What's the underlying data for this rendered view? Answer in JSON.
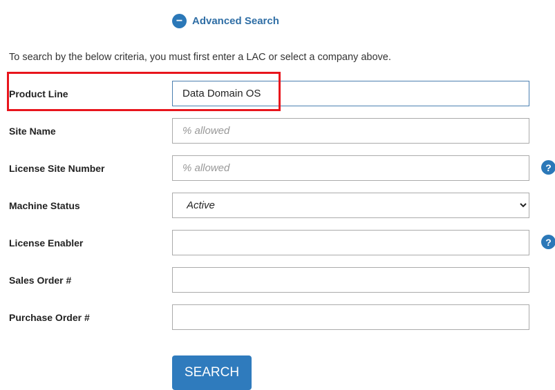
{
  "advanced_search": {
    "label": "Advanced Search",
    "icon": "minus-circle-icon"
  },
  "intro": "To search by the below criteria, you must first enter a LAC or select a company above.",
  "fields": [
    {
      "label": "Product Line",
      "value": "Data Domain OS",
      "placeholder": ""
    },
    {
      "label": "Site Name",
      "value": "",
      "placeholder": "% allowed"
    },
    {
      "label": "License Site Number",
      "value": "",
      "placeholder": "% allowed"
    },
    {
      "label": "Machine Status",
      "value": "Active"
    },
    {
      "label": "License Enabler",
      "value": "",
      "placeholder": ""
    },
    {
      "label": "Sales Order #",
      "value": "",
      "placeholder": ""
    },
    {
      "label": "Purchase Order #",
      "value": "",
      "placeholder": ""
    }
  ],
  "help_glyph": "?",
  "search_label": "SEARCH",
  "colors": {
    "accent": "#2b78b8",
    "highlight": "#e8141c"
  }
}
